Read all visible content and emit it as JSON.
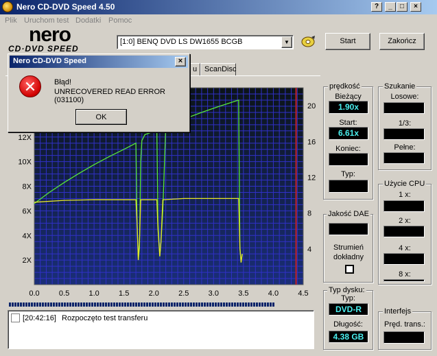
{
  "window": {
    "title": "Nero CD-DVD Speed 4.50",
    "controls": [
      "?",
      "_",
      "□",
      "×"
    ]
  },
  "menu": [
    "Plik",
    "Uruchom test",
    "Dodatki",
    "Pomoc"
  ],
  "logo": {
    "brand": "nero",
    "sub": "CD·DVD SPEED"
  },
  "toolbar": {
    "drive": "[1:0]   BENQ DVD LS DW1655 BCGB",
    "start_label": "Start",
    "quit_label": "Zakończ"
  },
  "tabs": [
    "u",
    "ScanDisc"
  ],
  "progress": {
    "fraction": 0.85
  },
  "log": {
    "time": "[20:42:16]",
    "message": "Rozpoczęto test transferu"
  },
  "speed_panel": {
    "title": "prędkość",
    "current_label": "Bieżący",
    "current_value": "1.90x",
    "start_label": "Start:",
    "start_value": "6.61x",
    "end_label": "Koniec:",
    "end_value": "",
    "type_label": "Typ:",
    "type_value": ""
  },
  "seek_panel": {
    "title": "Szukanie",
    "random_label": "Losowe:",
    "third_label": "1/3:",
    "full_label": "Pełne:"
  },
  "dae_panel": {
    "title": "Jakość DAE",
    "stream_label": "Strumień dokładny"
  },
  "cpu_panel": {
    "title": "Użycie CPU",
    "labels": [
      "1 x:",
      "2 x:",
      "4 x:",
      "8 x:"
    ]
  },
  "disc_panel": {
    "title": "Typ dysku:",
    "type_label": "Typ:",
    "type_value": "DVD-R",
    "length_label": "Długość:",
    "length_value": "4.38 GB"
  },
  "interface_panel": {
    "title": "Interfejs",
    "burst_label": "Pręd. trans.:"
  },
  "dialog": {
    "title": "Nero CD-DVD Speed",
    "close": "×",
    "icon": "error-icon",
    "line1": "Błąd!",
    "line2": "UNRECOVERED READ ERROR (031100)",
    "ok_label": "OK"
  },
  "colors": {
    "chart_bg_top": "#0c1418",
    "chart_bg_bottom": "#1a2e78",
    "grid": "#3030c8",
    "speed_line": "#58e838",
    "rpm_line": "#e8e828",
    "marker": "#c02020",
    "cyan": "#4af0f0"
  },
  "chart_data": {
    "type": "line",
    "x_ticks": [
      "0.0",
      "0.5",
      "1.0",
      "1.5",
      "2.0",
      "2.5",
      "3.0",
      "3.5",
      "4.0",
      "4.5"
    ],
    "y_left_ticks": [
      "2X",
      "4X",
      "6X",
      "8X",
      "10X",
      "12X"
    ],
    "y_right_ticks": [
      "4",
      "8",
      "12",
      "16",
      "20"
    ],
    "xlim": [
      0,
      4.5
    ],
    "ylim_left": [
      0,
      16
    ],
    "ylim_right": [
      0,
      22
    ],
    "end_marker_x": 4.38,
    "series": [
      {
        "points": [
          [
            0,
            6.6
          ],
          [
            0.25,
            7.5
          ],
          [
            0.5,
            8.3
          ],
          [
            0.75,
            9.05
          ],
          [
            1.0,
            9.75
          ],
          [
            1.25,
            10.4
          ],
          [
            1.5,
            11.0
          ],
          [
            1.7,
            11.5
          ],
          [
            1.72,
            5
          ],
          [
            1.74,
            2
          ],
          [
            1.76,
            3
          ],
          [
            1.78,
            10
          ],
          [
            1.8,
            11.7
          ],
          [
            1.85,
            12.2
          ],
          [
            2.0,
            12.45
          ],
          [
            2.05,
            12.6
          ],
          [
            2.07,
            5
          ],
          [
            2.1,
            2.3
          ],
          [
            2.12,
            3.5
          ],
          [
            2.15,
            6
          ],
          [
            2.2,
            12.8
          ],
          [
            2.5,
            13.45
          ],
          [
            2.8,
            14.0
          ],
          [
            3.1,
            14.5
          ],
          [
            3.42,
            15.0
          ],
          [
            3.44,
            3
          ],
          [
            3.46,
            1.8
          ],
          [
            3.48,
            2.5
          ]
        ]
      },
      {
        "points": [
          [
            0,
            6.7
          ],
          [
            0.5,
            6.85
          ],
          [
            1.0,
            6.9
          ],
          [
            1.5,
            6.9
          ],
          [
            1.7,
            6.9
          ],
          [
            1.72,
            5
          ],
          [
            1.74,
            2
          ],
          [
            1.76,
            3.5
          ],
          [
            1.78,
            6.9
          ],
          [
            2.05,
            6.9
          ],
          [
            2.07,
            4.5
          ],
          [
            2.1,
            2.3
          ],
          [
            2.12,
            3.5
          ],
          [
            2.15,
            6.9
          ],
          [
            2.5,
            7.0
          ],
          [
            3.0,
            7.0
          ],
          [
            3.42,
            7.0
          ],
          [
            3.44,
            3
          ],
          [
            3.46,
            1.8
          ],
          [
            3.48,
            2.5
          ]
        ]
      }
    ]
  }
}
